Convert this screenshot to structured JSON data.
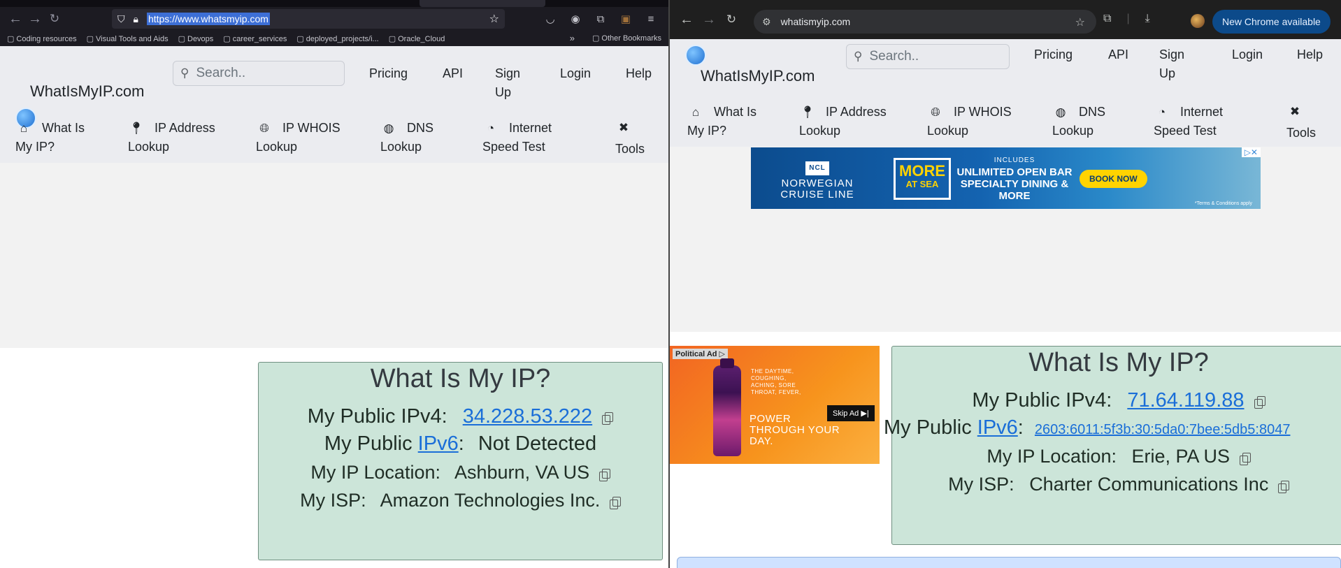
{
  "left_browser": {
    "url": "https://www.whatsmyip.com",
    "bookmarks": [
      "Coding resources",
      "Visual Tools and Aids",
      "Devops",
      "career_services",
      "deployed_projects/i...",
      "Oracle_Cloud"
    ],
    "other_bookmarks": "Other Bookmarks"
  },
  "right_browser": {
    "url": "whatismyip.com",
    "update_button": "New Chrome available"
  },
  "site": {
    "logo_text": "WhatIsMyIP.com",
    "search_placeholder": "Search..",
    "top_links": [
      "Pricing",
      "API",
      "Sign Up",
      "Login",
      "Help"
    ],
    "nav": [
      {
        "label": "What Is My IP?",
        "icon": "home-icon"
      },
      {
        "label": "IP Address Lookup",
        "icon": "map-pin-icon"
      },
      {
        "label": "IP WHOIS Lookup",
        "icon": "globe-icon"
      },
      {
        "label": "DNS Lookup",
        "icon": "dns-icon"
      },
      {
        "label": "Internet Speed Test",
        "icon": "speedometer-icon"
      },
      {
        "label": "Tools",
        "icon": "tools-icon"
      }
    ]
  },
  "left_result": {
    "heading": "What Is My IP?",
    "ipv4_label": "My Public IPv4:",
    "ipv4_value": "34.228.53.222",
    "ipv6_label_prefix": "My Public",
    "ipv6_link": "IPv6",
    "ipv6_value": "Not Detected",
    "location_label": "My IP Location:",
    "location_value": "Ashburn, VA US",
    "isp_label": "My ISP:",
    "isp_value": "Amazon Technologies Inc."
  },
  "right_result": {
    "heading": "What Is My IP?",
    "ipv4_label": "My Public IPv4:",
    "ipv4_value": "71.64.119.88",
    "ipv6_label_prefix": "My Public",
    "ipv6_link": "IPv6",
    "ipv6_value": "2603:6011:5f3b:30:5da0:7bee:5db5:8047",
    "location_label": "My IP Location:",
    "location_value": "Erie, PA US",
    "isp_label": "My ISP:",
    "isp_value": "Charter Communications Inc"
  },
  "ads": {
    "ncl_brand": "NORWEGIAN CRUISE LINE",
    "ncl_logo": "NCL",
    "ncl_more": "MORE",
    "ncl_at_sea": "AT SEA",
    "ncl_includes": "INCLUDES",
    "ncl_offer": "UNLIMITED OPEN BAR SPECIALTY DINING & MORE",
    "ncl_book": "BOOK NOW",
    "ncl_fine": "*Terms & Conditions apply",
    "political_tag": "Political Ad ▷",
    "dayquil_small": "THE DAYTIME, COUGHING, ACHING, SORE THROAT, FEVER,",
    "dayquil_power": "POWER THROUGH YOUR DAY.",
    "skip": "Skip Ad ▶|"
  }
}
